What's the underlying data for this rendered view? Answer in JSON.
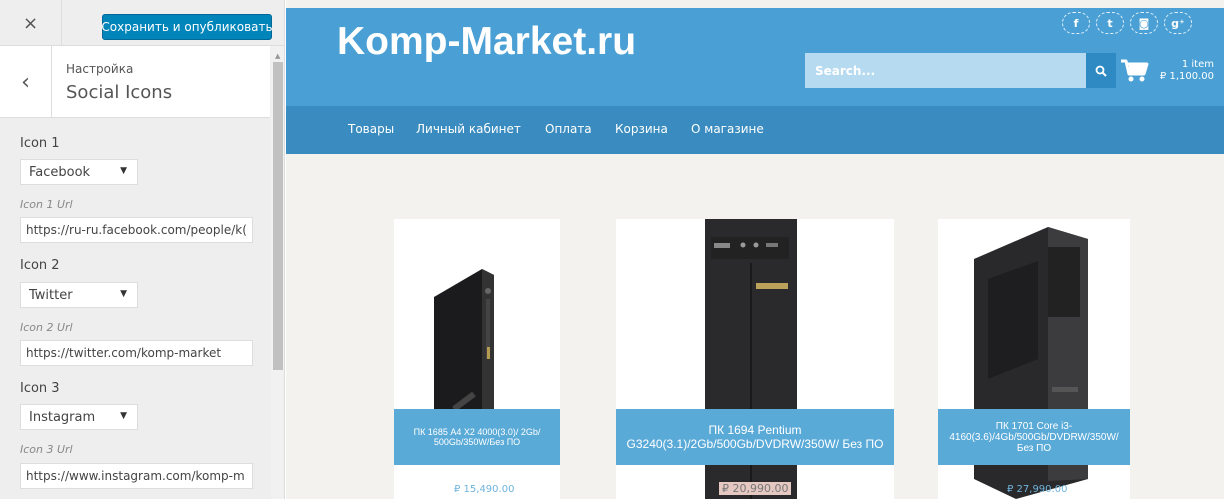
{
  "sidebar": {
    "close_symbol": "×",
    "publish_label": "Сохранить и опубликовать",
    "back_symbol": "‹",
    "breadcrumb": "Настройка",
    "section_title": "Social Icons",
    "controls": [
      {
        "label": "Icon 1",
        "value": "Facebook",
        "url_label": "Icon 1 Url",
        "url_value": "https://ru-ru.facebook.com/people/k("
      },
      {
        "label": "Icon 2",
        "value": "Twitter",
        "url_label": "Icon 2 Url",
        "url_value": "https://twitter.com/komp-market"
      },
      {
        "label": "Icon 3",
        "value": "Instagram",
        "url_label": "Icon 3 Url",
        "url_value": "https://www.instagram.com/komp-m"
      }
    ]
  },
  "site": {
    "logo": "Komp-Market.ru",
    "social_icons": [
      {
        "name": "facebook-icon",
        "glyph": "f"
      },
      {
        "name": "twitter-icon",
        "glyph": "t"
      },
      {
        "name": "instagram-icon",
        "glyph": "◙"
      },
      {
        "name": "google-plus-icon",
        "glyph": "g⁺"
      }
    ],
    "search_placeholder": "Search...",
    "cart": {
      "count": "1 item",
      "total": "₽ 1,100.00"
    },
    "nav": [
      "Товары",
      "Личный кабинет",
      "Оплата",
      "Корзина",
      "О магазине"
    ],
    "products": [
      {
        "title": "ПК 1685 A4 X2 4000(3.0)/ 2Gb/ 500Gb/350W/Без ПО",
        "price": "₽ 15,490.00"
      },
      {
        "title": "ПК 1694 Pentium G3240(3.1)/2Gb/500Gb/DVDRW/350W/ Без ПО",
        "price": "₽ 20,990.00"
      },
      {
        "title": "ПК 1701 Core i3-4160(3.6)/4Gb/500Gb/DVDRW/350W/Без ПО",
        "price": "₽ 27,990.00"
      }
    ],
    "colors": {
      "header": "#4aa0d5",
      "nav": "#3a8cc0",
      "publish": "#0085ba"
    }
  }
}
